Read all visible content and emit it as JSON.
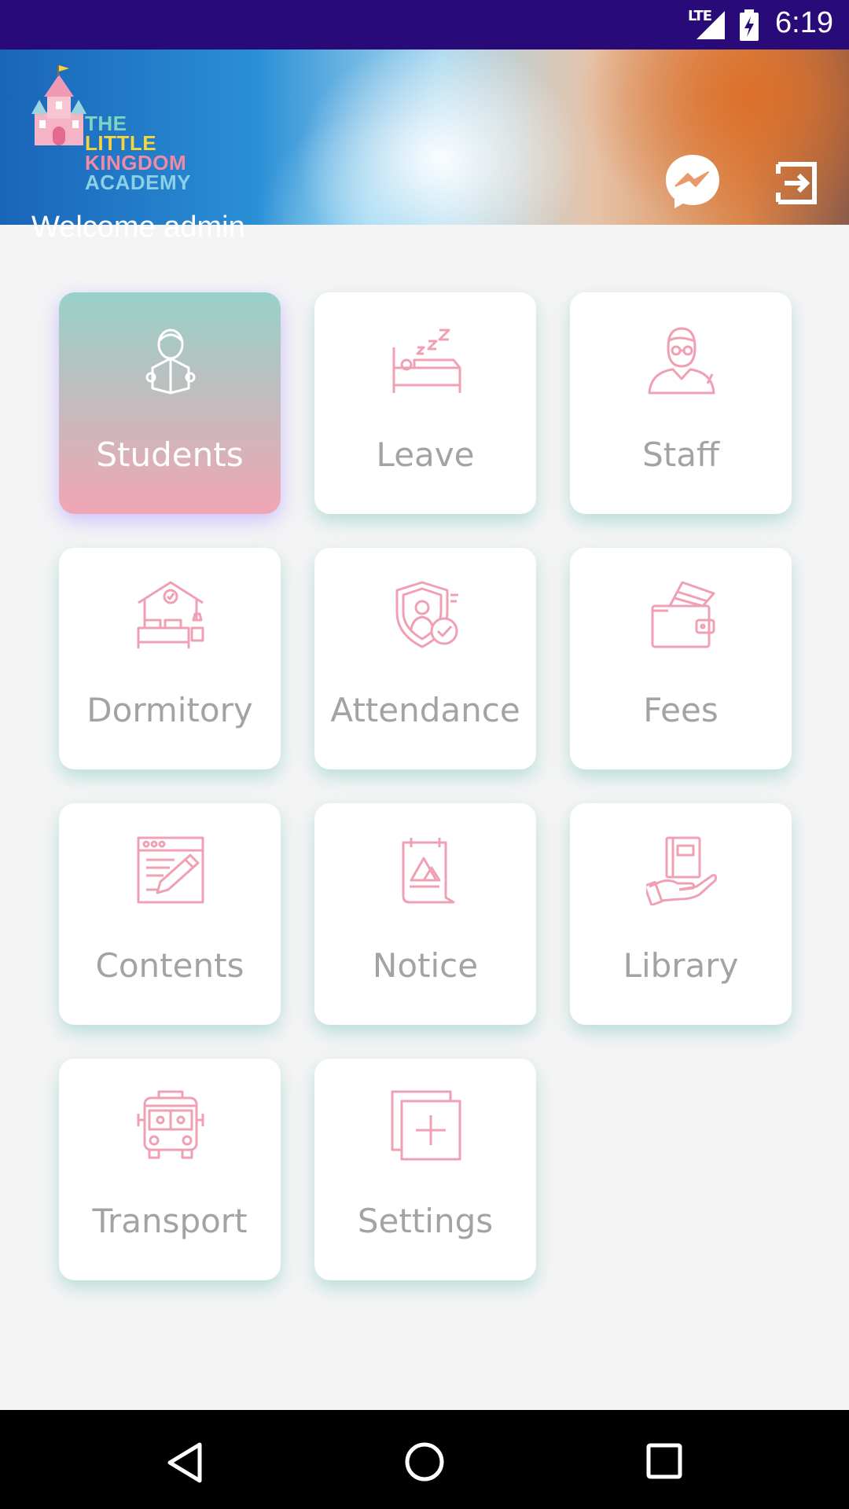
{
  "status_bar": {
    "network": "LTE",
    "time": "6:19"
  },
  "header": {
    "logo_lines": [
      "THE",
      "LITTLE",
      "KINGDOM",
      "ACADEMY"
    ],
    "welcome": "Welcome admin",
    "messenger_icon": "messenger-icon",
    "logout_icon": "logout-icon"
  },
  "menu": {
    "items": [
      {
        "label": "Students",
        "icon": "student-reading-icon",
        "active": true
      },
      {
        "label": "Leave",
        "icon": "sleeping-bed-icon",
        "active": false
      },
      {
        "label": "Staff",
        "icon": "teacher-icon",
        "active": false
      },
      {
        "label": "Dormitory",
        "icon": "dormitory-icon",
        "active": false
      },
      {
        "label": "Attendance",
        "icon": "attendance-shield-icon",
        "active": false
      },
      {
        "label": "Fees",
        "icon": "wallet-icon",
        "active": false
      },
      {
        "label": "Contents",
        "icon": "content-edit-icon",
        "active": false
      },
      {
        "label": "Notice",
        "icon": "notice-board-icon",
        "active": false
      },
      {
        "label": "Library",
        "icon": "book-hand-icon",
        "active": false
      },
      {
        "label": "Transport",
        "icon": "bus-icon",
        "active": false
      },
      {
        "label": "Settings",
        "icon": "settings-plus-icon",
        "active": false
      }
    ]
  },
  "colors": {
    "status_bar": "#290a79",
    "icon_pink": "#f0a0b4",
    "label_gray": "#a3a3a3",
    "active_gradient_top": "#98d1c8",
    "active_gradient_bottom": "#f0a6b4"
  },
  "nav_bar": {
    "back_icon": "back-triangle-icon",
    "home_icon": "home-circle-icon",
    "recent_icon": "recent-square-icon"
  }
}
